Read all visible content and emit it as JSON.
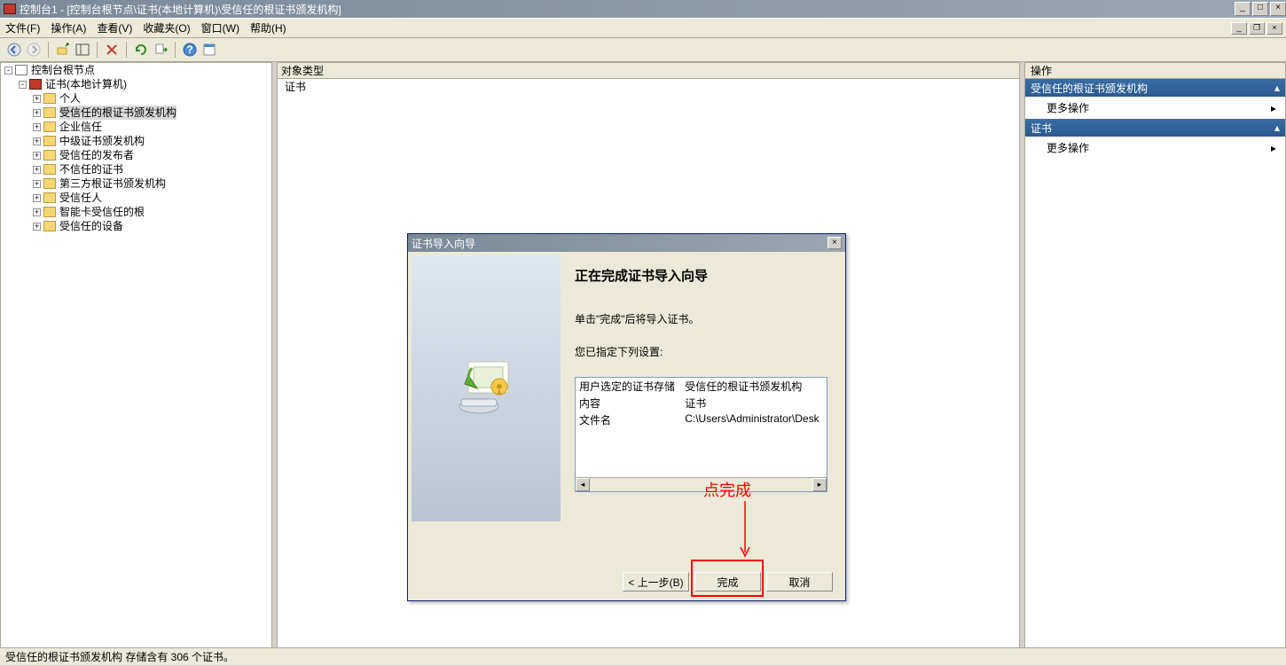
{
  "window": {
    "title": "控制台1 - [控制台根节点\\证书(本地计算机)\\受信任的根证书颁发机构]"
  },
  "menu": {
    "file": "文件(F)",
    "action": "操作(A)",
    "view": "查看(V)",
    "favorites": "收藏夹(O)",
    "window": "窗口(W)",
    "help": "帮助(H)"
  },
  "tree": {
    "root": "控制台根节点",
    "certs": "证书(本地计算机)",
    "items": [
      "个人",
      "受信任的根证书颁发机构",
      "企业信任",
      "中级证书颁发机构",
      "受信任的发布者",
      "不信任的证书",
      "第三方根证书颁发机构",
      "受信任人",
      "智能卡受信任的根",
      "受信任的设备"
    ]
  },
  "center": {
    "header": "对象类型",
    "item": "证书"
  },
  "actions": {
    "header": "操作",
    "section1": "受信任的根证书颁发机构",
    "more1": "更多操作",
    "section2": "证书",
    "more2": "更多操作"
  },
  "dialog": {
    "title": "证书导入向导",
    "heading": "正在完成证书导入向导",
    "instruction": "单击\"完成\"后将导入证书。",
    "settings_label": "您已指定下列设置:",
    "settings": {
      "r1k": "用户选定的证书存储",
      "r1v": "受信任的根证书颁发机构",
      "r2k": "内容",
      "r2v": "证书",
      "r3k": "文件名",
      "r3v": "C:\\Users\\Administrator\\Desk"
    },
    "back": "< 上一步(B)",
    "finish": "完成",
    "cancel": "取消"
  },
  "annotation": {
    "text": "点完成"
  },
  "status": "受信任的根证书颁发机构 存储含有 306 个证书。"
}
